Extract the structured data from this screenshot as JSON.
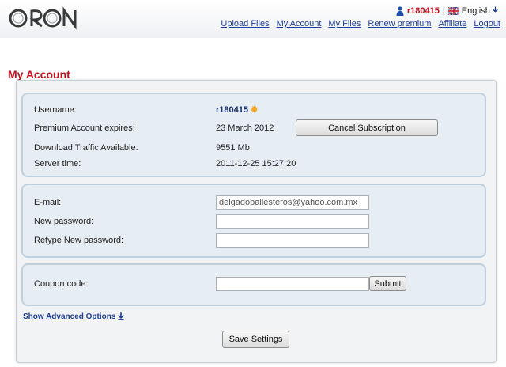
{
  "header": {
    "logo_text": "ORON",
    "username": "r180415",
    "separator": "|",
    "language": "English",
    "nav": [
      {
        "label": "Upload Files"
      },
      {
        "label": "My Account"
      },
      {
        "label": "My Files"
      },
      {
        "label": "Renew premium"
      },
      {
        "label": "Affiliate"
      },
      {
        "label": "Logout"
      }
    ]
  },
  "page_title": "My Account",
  "account": {
    "username_label": "Username:",
    "username_value": "r180415",
    "expires_label": "Premium Account expires:",
    "expires_value": "23 March 2012",
    "cancel_label": "Cancel Subscription",
    "traffic_label": "Download Traffic Available:",
    "traffic_value": "9551 Mb",
    "server_time_label": "Server time:",
    "server_time_value": "2011-12-25 15:27:20"
  },
  "credentials": {
    "email_label": "E-mail:",
    "email_value": "delgadoballesteros@yahoo.com.mx",
    "new_password_label": "New password:",
    "retype_password_label": "Retype New password:"
  },
  "coupon": {
    "label": "Coupon code:",
    "submit_label": "Submit"
  },
  "advanced_label": "Show Advanced Options",
  "save_label": "Save Settings",
  "colors": {
    "accent_red": "#c0101a",
    "link_blue": "#1f3f99",
    "panel_bg": "#e6edf3",
    "panel_border": "#bed0de"
  }
}
